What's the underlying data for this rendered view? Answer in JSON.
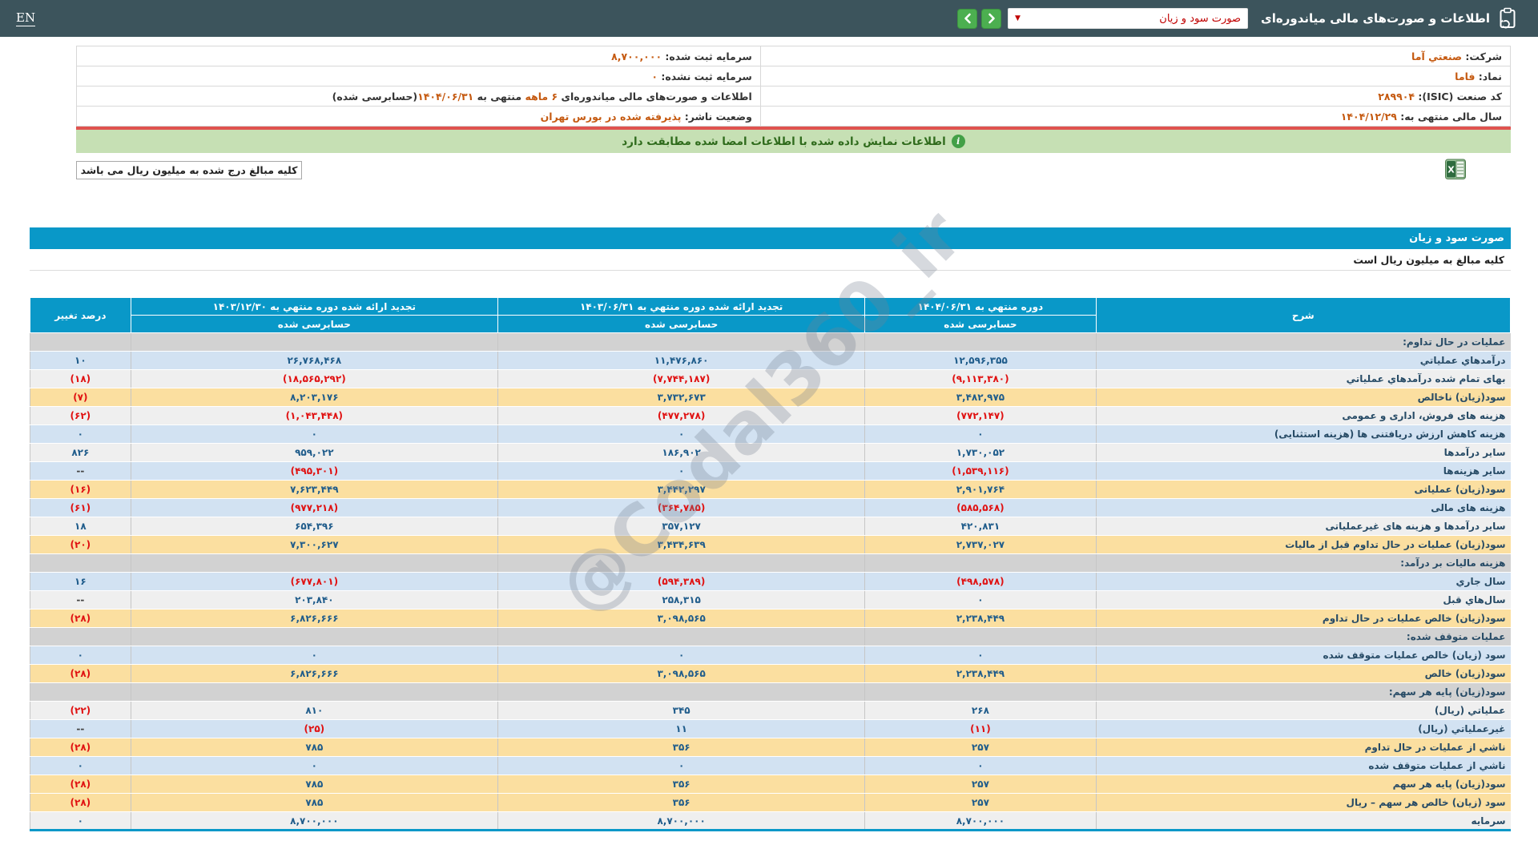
{
  "header": {
    "title": "اطلاعات و صورت‌های مالی میاندوره‌ای",
    "select_value": "صورت سود و زیان",
    "lang_toggle": "EN"
  },
  "company_info": {
    "rows": [
      {
        "right": [
          {
            "text": "شرکت: ",
            "style": "label"
          },
          {
            "text": "صنعتي آما",
            "style": "value"
          }
        ],
        "left": [
          {
            "text": "سرمایه ثبت شده: ",
            "style": "label"
          },
          {
            "text": "۸,۷۰۰,۰۰۰",
            "style": "value"
          }
        ]
      },
      {
        "right": [
          {
            "text": "نماد: ",
            "style": "label"
          },
          {
            "text": "فاما",
            "style": "value"
          }
        ],
        "left": [
          {
            "text": "سرمایه ثبت نشده: ",
            "style": "label"
          },
          {
            "text": "۰",
            "style": "value"
          }
        ]
      },
      {
        "right": [
          {
            "text": "کد صنعت (ISIC): ",
            "style": "label"
          },
          {
            "text": "۲۸۹۹۰۴",
            "style": "value"
          }
        ],
        "left": [
          {
            "text": "اطلاعات و صورت‌های مالی میاندوره‌ای ",
            "style": "label"
          },
          {
            "text": "۶ ماهه",
            "style": "value"
          },
          {
            "text": " منتهی به ",
            "style": "label"
          },
          {
            "text": "۱۴۰۴/۰۶/۳۱",
            "style": "value"
          },
          {
            "text": "(حسابرسی شده)",
            "style": "label"
          }
        ]
      },
      {
        "right": [
          {
            "text": "سال مالی منتهی به: ",
            "style": "label"
          },
          {
            "text": "۱۴۰۴/۱۲/۲۹",
            "style": "value"
          }
        ],
        "left": [
          {
            "text": "وضعیت ناشر: ",
            "style": "label"
          },
          {
            "text": "پذيرفته شده در بورس تهران",
            "style": "value"
          }
        ]
      }
    ]
  },
  "banner": {
    "text": "اطلاعات نمایش داده شده با اطلاعات امضا شده مطابقت دارد"
  },
  "notes": {
    "amounts_note": "کلیه مبالغ درج شده به میلیون ریال می باشد"
  },
  "statement": {
    "title": "صورت سود و زیان",
    "unit_note": "کلیه مبالغ به میلیون ریال است"
  },
  "watermark": {
    "text": "@Codal360_ir"
  },
  "table": {
    "columns": [
      {
        "label": "شرح"
      },
      {
        "label": "دوره منتهي به ۱۴۰۴/۰۶/۳۱",
        "sub": "حسابرسی شده"
      },
      {
        "label": "تجدید ارائه شده دوره منتهي به ۱۴۰۳/۰۶/۳۱",
        "sub": "حسابرسی شده"
      },
      {
        "label": "تجدید ارائه شده دوره منتهي به ۱۴۰۳/۱۲/۳۰",
        "sub": "حسابرسی شده"
      },
      {
        "label": "درصد تغییر"
      }
    ],
    "rows": [
      {
        "variant": "section",
        "desc": "عملیات در حال تداوم:",
        "v1": "",
        "v2": "",
        "v3": "",
        "pct": ""
      },
      {
        "variant": "blue",
        "desc": "درآمدهاي عملياتي",
        "v1": "۱۲,۵۹۶,۳۵۵",
        "v2": "۱۱,۴۷۶,۸۶۰",
        "v3": "۲۶,۷۶۸,۴۶۸",
        "pct": "۱۰"
      },
      {
        "variant": "gray",
        "desc": "بهای تمام شده درآمدهاي عملياتي",
        "v1": "(۹,۱۱۳,۳۸۰)",
        "v2": "(۷,۷۴۴,۱۸۷)",
        "v3": "(۱۸,۵۶۵,۲۹۲)",
        "pct": "(۱۸)"
      },
      {
        "variant": "tan",
        "desc": "سود(زيان) ناخالص",
        "v1": "۳,۴۸۲,۹۷۵",
        "v2": "۳,۷۳۲,۶۷۳",
        "v3": "۸,۲۰۳,۱۷۶",
        "pct": "(۷)"
      },
      {
        "variant": "gray",
        "desc": "هزینه های فروش، اداری و عمومی",
        "v1": "(۷۷۲,۱۴۷)",
        "v2": "(۴۷۷,۲۷۸)",
        "v3": "(۱,۰۴۳,۴۴۸)",
        "pct": "(۶۲)"
      },
      {
        "variant": "blue",
        "desc": "هزینه کاهش ارزش دریافتنی ها (هزینه استثنایی)",
        "v1": "۰",
        "v2": "۰",
        "v3": "۰",
        "pct": "۰"
      },
      {
        "variant": "gray",
        "desc": "سایر درآمدها",
        "v1": "۱,۷۳۰,۰۵۲",
        "v2": "۱۸۶,۹۰۲",
        "v3": "۹۵۹,۰۲۲",
        "pct": "۸۲۶"
      },
      {
        "variant": "blue",
        "desc": "سایر هزینه‌ها",
        "v1": "(۱,۵۳۹,۱۱۶)",
        "v2": "۰",
        "v3": "(۴۹۵,۳۰۱)",
        "pct": "--"
      },
      {
        "variant": "tan",
        "desc": "سود(زيان) عملياتی",
        "v1": "۲,۹۰۱,۷۶۴",
        "v2": "۳,۴۴۲,۲۹۷",
        "v3": "۷,۶۲۳,۴۴۹",
        "pct": "(۱۶)"
      },
      {
        "variant": "blue",
        "desc": "هزینه های مالی",
        "v1": "(۵۸۵,۵۶۸)",
        "v2": "(۳۶۴,۷۸۵)",
        "v3": "(۹۷۷,۲۱۸)",
        "pct": "(۶۱)"
      },
      {
        "variant": "gray",
        "desc": "سایر درآمدها و هزینه های غیرعملیاتی",
        "v1": "۴۲۰,۸۳۱",
        "v2": "۳۵۷,۱۲۷",
        "v3": "۶۵۴,۳۹۶",
        "pct": "۱۸"
      },
      {
        "variant": "tan",
        "desc": "سود(زيان) عمليات در حال تداوم قبل از ماليات",
        "v1": "۲,۷۳۷,۰۲۷",
        "v2": "۳,۴۳۴,۶۳۹",
        "v3": "۷,۳۰۰,۶۲۷",
        "pct": "(۲۰)"
      },
      {
        "variant": "section",
        "desc": "هزينه ماليات بر درآمد:",
        "v1": "",
        "v2": "",
        "v3": "",
        "pct": ""
      },
      {
        "variant": "blue",
        "desc": "سال جاري",
        "v1": "(۴۹۸,۵۷۸)",
        "v2": "(۵۹۴,۳۸۹)",
        "v3": "(۶۷۷,۸۰۱)",
        "pct": "۱۶"
      },
      {
        "variant": "gray",
        "desc": "سال‌هاي قبل",
        "v1": "۰",
        "v2": "۲۵۸,۳۱۵",
        "v3": "۲۰۳,۸۴۰",
        "pct": "--"
      },
      {
        "variant": "tan",
        "desc": "سود(زيان) خالص عمليات در حال تداوم",
        "v1": "۲,۲۳۸,۴۴۹",
        "v2": "۳,۰۹۸,۵۶۵",
        "v3": "۶,۸۲۶,۶۶۶",
        "pct": "(۲۸)"
      },
      {
        "variant": "section",
        "desc": "عمليات متوقف شده:",
        "v1": "",
        "v2": "",
        "v3": "",
        "pct": ""
      },
      {
        "variant": "blue",
        "desc": "سود (زيان) خالص عمليات متوقف شده",
        "v1": "۰",
        "v2": "۰",
        "v3": "۰",
        "pct": "۰"
      },
      {
        "variant": "tan",
        "desc": "سود(زيان) خالص",
        "v1": "۲,۲۳۸,۴۴۹",
        "v2": "۳,۰۹۸,۵۶۵",
        "v3": "۶,۸۲۶,۶۶۶",
        "pct": "(۲۸)"
      },
      {
        "variant": "section",
        "desc": "سود(زيان) پايه هر سهم:",
        "v1": "",
        "v2": "",
        "v3": "",
        "pct": ""
      },
      {
        "variant": "gray",
        "desc": "عملياتي (ريال)",
        "v1": "۲۶۸",
        "v2": "۳۴۵",
        "v3": "۸۱۰",
        "pct": "(۲۲)"
      },
      {
        "variant": "blue",
        "desc": "غيرعملياتي (ريال)",
        "v1": "(۱۱)",
        "v2": "۱۱",
        "v3": "(۲۵)",
        "pct": "--"
      },
      {
        "variant": "tan",
        "desc": "ناشي از عمليات در حال تداوم",
        "v1": "۲۵۷",
        "v2": "۳۵۶",
        "v3": "۷۸۵",
        "pct": "(۲۸)"
      },
      {
        "variant": "blue",
        "desc": "ناشي از عمليات متوقف شده",
        "v1": "۰",
        "v2": "۰",
        "v3": "۰",
        "pct": "۰"
      },
      {
        "variant": "tan",
        "desc": "سود(زيان) پايه هر سهم",
        "v1": "۲۵۷",
        "v2": "۳۵۶",
        "v3": "۷۸۵",
        "pct": "(۲۸)"
      },
      {
        "variant": "tan",
        "desc": "سود (زيان) خالص هر سهم – ريال",
        "v1": "۲۵۷",
        "v2": "۳۵۶",
        "v3": "۷۸۵",
        "pct": "(۲۸)"
      },
      {
        "variant": "gray",
        "desc": "سرمايه",
        "v1": "۸,۷۰۰,۰۰۰",
        "v2": "۸,۷۰۰,۰۰۰",
        "v3": "۸,۷۰۰,۰۰۰",
        "pct": "۰"
      }
    ]
  },
  "colors": {
    "topbar_bg": "#3c545c",
    "accent_blue": "#0998c8",
    "row_blue": "#d2e2f2",
    "row_gray": "#efefef",
    "row_highlight_tan": "#fbdfa0",
    "row_section_gray": "#d2d2d2",
    "negative_red": "#e01111",
    "number_navy": "#1f5c8b",
    "info_value_orange": "#c55a11",
    "banner_green_bg": "#c6e0b4",
    "nav_button_green": "#4caf50",
    "red_divider": "#e0534f"
  }
}
